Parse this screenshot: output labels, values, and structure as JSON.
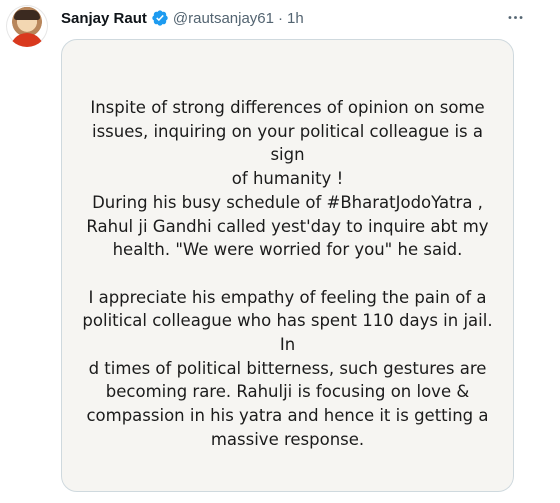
{
  "tweet": {
    "author_name": "Sanjay Raut",
    "handle": "@rautsanjay61",
    "separator": "·",
    "time": "1h",
    "more_icon": "more-horizontal-icon",
    "verified_icon": "verified-badge-icon",
    "accent_color": "#1d9bf0",
    "image_text": {
      "paragraph1_line1": "Inspite of strong differences of opinion on some",
      "paragraph1_line2": "issues, inquiring on your political colleague is a sign",
      "paragraph1_line3": "of humanity !",
      "paragraph1_line4": "During his busy schedule of #BharatJodoYatra ,",
      "paragraph1_line5": "Rahul ji Gandhi called yest'day to inquire abt my",
      "paragraph1_line6": "health. \"We were worried for you\" he said.",
      "paragraph2_line1": "I appreciate his empathy of feeling the pain of a",
      "paragraph2_line2": "political colleague who has spent 110 days in jail. In",
      "paragraph2_line3": "d times of political bitterness, such gestures are",
      "paragraph2_line4": "becoming rare. Rahulji is focusing on love &",
      "paragraph2_line5": "compassion in his yatra and hence it is getting a",
      "paragraph2_line6": "massive response."
    }
  }
}
